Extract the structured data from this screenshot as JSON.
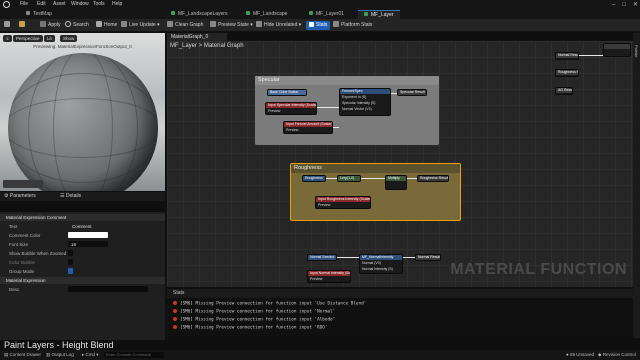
{
  "menu": [
    "File",
    "Edit",
    "Asset",
    "Window",
    "Tools",
    "Help"
  ],
  "project_tab": "TestMap",
  "doc_tabs": [
    {
      "label": "MF_LandscapeLayers",
      "color": "#3aa05a"
    },
    {
      "label": "MF_Landscape",
      "color": "#3aa05a"
    },
    {
      "label": "MF_Layer01",
      "color": "#3aa05a"
    },
    {
      "label": "MF_Layer",
      "color": "#3aa05a"
    }
  ],
  "toolbar": {
    "save": "",
    "apply": "Apply",
    "search": "Search",
    "home": "Home",
    "live_update": "Live Update",
    "clean_graph": "Clean Graph",
    "preview_state": "Preview State",
    "hide_unrelated": "Hide Unrelated",
    "stats": "Stats",
    "platform_stats": "Platform Stats"
  },
  "viewport": {
    "mode": "Perspective",
    "lit": "Lit",
    "show": "Show",
    "caption": "Previewing: MaterialExpressionFunctionOutput_0"
  },
  "details_tabs": {
    "parameters": "Parameters",
    "details": "Details"
  },
  "details": {
    "section1": "Material Expression Comment",
    "text_label": "Text",
    "text_value": "Comment",
    "color_label": "Comment Color",
    "font_label": "Font Size",
    "font_value": "18",
    "bubble_label": "Show Bubble When Zoomed",
    "bubble_color": "Color Bubble",
    "group_label": "Group Mode",
    "section2": "Material Expression",
    "desc_label": "Desc"
  },
  "graph": {
    "tab": "MaterialGraph_0",
    "breadcrumb": "MF_Layer  >  Material Graph",
    "watermark": "MATERIAL FUNCTION",
    "specular_title": "Specular",
    "roughness_title": "Roughness",
    "nodes": {
      "base_color": "Base Color Scalar",
      "spec_intensity": "Input Specular Intensity (Scalar)",
      "spec_preview": "Preview",
      "fresnel": "Input Fresnel Amount (Scalar)",
      "fresnel_preview": "Preview",
      "fresnel_fn": "Fresnel/Spec",
      "fresnel_a": "Exponent In (S)",
      "fresnel_b": "Specular Intensity (S)",
      "fresnel_c": "Normal Vector (V3)",
      "spec_out": "Specular Result",
      "rough_mask": "Roughness",
      "rough_lerp": "Lerp(1,0)",
      "multiply": "Multiply",
      "rough_out": "Roughness Result",
      "rough_input": "Input Roughness Intensity (Scalar)",
      "rough_preview": "Preview",
      "normal_in": "Normal Seeded",
      "normal_fn": "MF_NormalIntensity",
      "normal_a": "Normal (V3)",
      "normal_b": "Normal Intensity (S)",
      "normal_out": "Normal Result",
      "normal_input": "Input Normal Intensity (Scalar)",
      "normal_preview": "Preview",
      "out_normal": "Normal Result",
      "out_rough": "Roughness Result",
      "out_ao": "AO Result"
    }
  },
  "right_rail": "Palette",
  "stats_tab": "Stats",
  "stats": [
    "[SM6] Missing Preview connection for function input 'Use Distance Blend'",
    "[SM6] Missing Preview connection for function input 'Normal'",
    "[SM6] Missing Preview connection for function input 'Albedo'",
    "[SM6] Missing Preview connection for function input 'RDO'"
  ],
  "caption": "Paint Layers - Height Blend",
  "statusbar": {
    "content_drawer": "Content Drawer",
    "output_log": "Output Log",
    "cmd": "Cmd",
    "cmd_placeholder": "Enter Console Command",
    "unsaved": "69 Unsaved",
    "revision": "Revision Control"
  }
}
